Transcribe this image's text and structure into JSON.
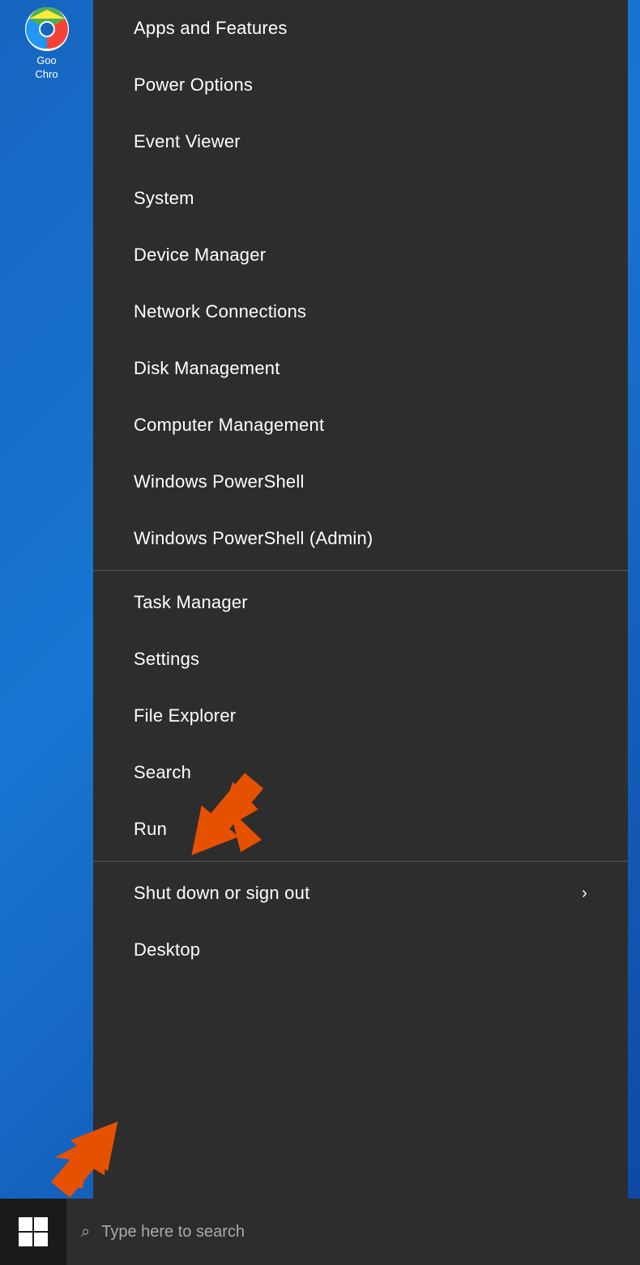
{
  "desktop": {
    "chrome_label_line1": "Goo",
    "chrome_label_line2": "Chro"
  },
  "context_menu": {
    "items": [
      {
        "id": "apps-features",
        "label": "Apps and Features",
        "has_arrow": false,
        "divider_before": false
      },
      {
        "id": "power-options",
        "label": "Power Options",
        "has_arrow": false,
        "divider_before": false
      },
      {
        "id": "event-viewer",
        "label": "Event Viewer",
        "has_arrow": false,
        "divider_before": false
      },
      {
        "id": "system",
        "label": "System",
        "has_arrow": false,
        "divider_before": false
      },
      {
        "id": "device-manager",
        "label": "Device Manager",
        "has_arrow": false,
        "divider_before": false
      },
      {
        "id": "network-connections",
        "label": "Network Connections",
        "has_arrow": false,
        "divider_before": false
      },
      {
        "id": "disk-management",
        "label": "Disk Management",
        "has_arrow": false,
        "divider_before": false
      },
      {
        "id": "computer-management",
        "label": "Computer Management",
        "has_arrow": false,
        "divider_before": false
      },
      {
        "id": "windows-powershell",
        "label": "Windows PowerShell",
        "has_arrow": false,
        "divider_before": false
      },
      {
        "id": "windows-powershell-admin",
        "label": "Windows PowerShell (Admin)",
        "has_arrow": false,
        "divider_before": false
      },
      {
        "id": "task-manager",
        "label": "Task Manager",
        "has_arrow": false,
        "divider_before": true
      },
      {
        "id": "settings",
        "label": "Settings",
        "has_arrow": false,
        "divider_before": false
      },
      {
        "id": "file-explorer",
        "label": "File Explorer",
        "has_arrow": false,
        "divider_before": false
      },
      {
        "id": "search",
        "label": "Search",
        "has_arrow": false,
        "divider_before": false
      },
      {
        "id": "run",
        "label": "Run",
        "has_arrow": false,
        "divider_before": false
      },
      {
        "id": "shut-down",
        "label": "Shut down or sign out",
        "has_arrow": true,
        "divider_before": true
      },
      {
        "id": "desktop",
        "label": "Desktop",
        "has_arrow": false,
        "divider_before": false
      }
    ]
  },
  "taskbar": {
    "search_placeholder": "Type here to search",
    "start_button_label": "Start"
  }
}
